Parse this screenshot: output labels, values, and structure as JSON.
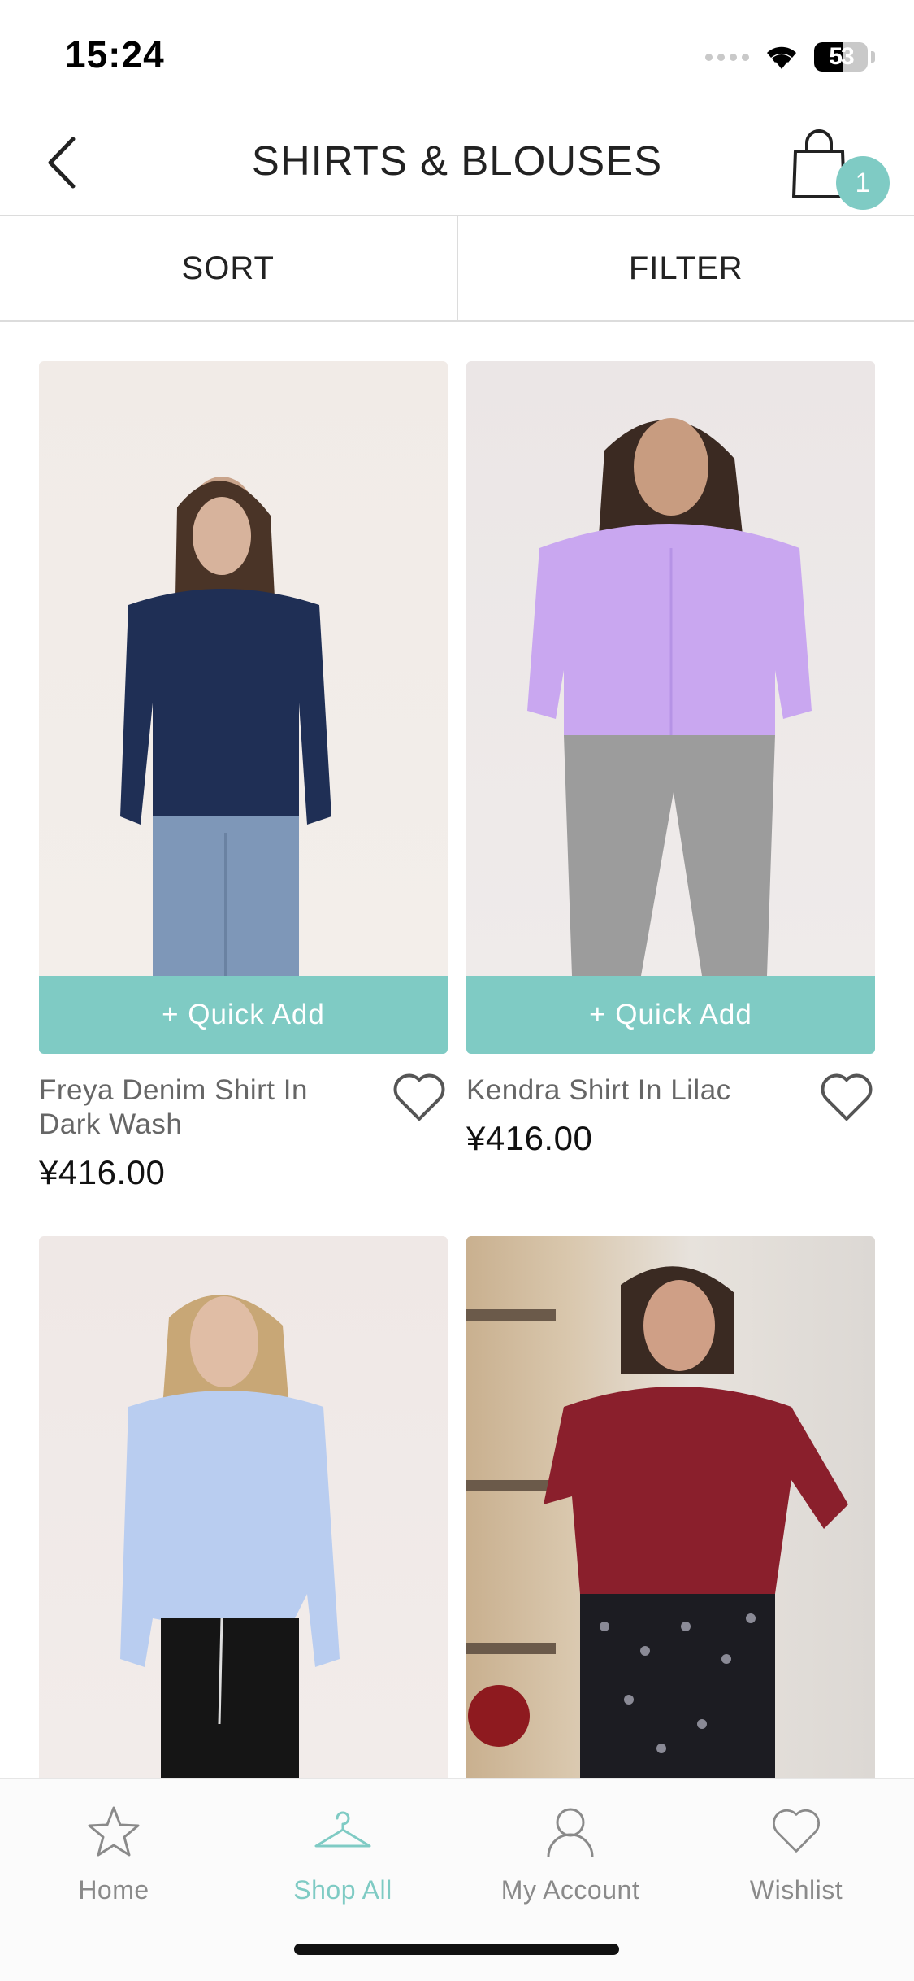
{
  "status_bar": {
    "time": "15:24",
    "battery": "53",
    "battery_level": 0.53
  },
  "header": {
    "title": "SHIRTS & BLOUSES",
    "cart_count": "1"
  },
  "toolbar": {
    "sort_label": "SORT",
    "filter_label": "FILTER"
  },
  "products": [
    {
      "name": "Freya Denim Shirt In Dark Wash",
      "price": "¥416.00",
      "quick_add": "+ Quick Add"
    },
    {
      "name": "Kendra Shirt In Lilac",
      "price": "¥416.00",
      "quick_add": "+ Quick Add"
    },
    {
      "name": "",
      "price": "",
      "quick_add": ""
    },
    {
      "name": "",
      "price": "",
      "quick_add": ""
    }
  ],
  "bottom_nav": [
    {
      "label": "Home",
      "icon": "star-icon",
      "active": false
    },
    {
      "label": "Shop All",
      "icon": "hanger-icon",
      "active": true
    },
    {
      "label": "My Account",
      "icon": "user-icon",
      "active": false
    },
    {
      "label": "Wishlist",
      "icon": "heart-icon",
      "active": false
    }
  ],
  "colors": {
    "accent": "#7fcbc4",
    "text": "#222222",
    "muted": "#8a8a8a"
  }
}
